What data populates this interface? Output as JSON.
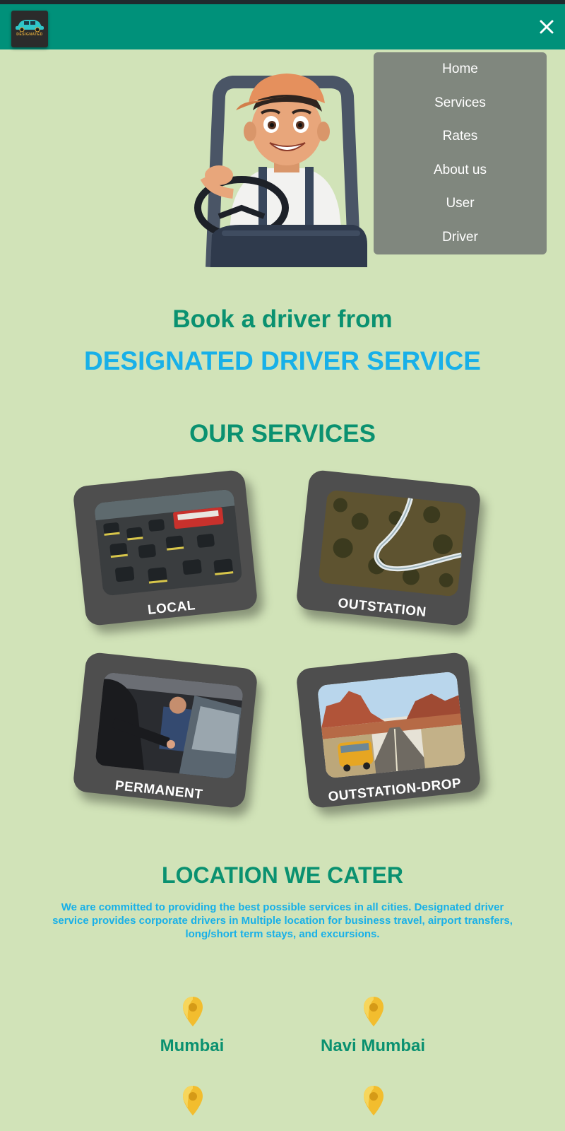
{
  "header": {
    "logo_icon": "car-logo-icon",
    "logo_text": "DESIGNATED",
    "close_icon": "close-icon",
    "bg_color": "#00917a"
  },
  "menu": {
    "items": [
      "Home",
      "Services",
      "Rates",
      "About us",
      "User",
      "Driver"
    ]
  },
  "hero": {
    "image": "cartoon-driver-illustration",
    "line1": "Book a driver from",
    "line2": "DESIGNATED DRIVER SERVICE"
  },
  "services": {
    "title": "OUR SERVICES",
    "cards": [
      {
        "label": "LOCAL",
        "image": "city-traffic-photo"
      },
      {
        "label": "OUTSTATION",
        "image": "mountain-road-photo"
      },
      {
        "label": "PERMANENT",
        "image": "chauffeur-door-photo"
      },
      {
        "label": "OUTSTATION-DROP",
        "image": "desert-road-van-photo"
      }
    ]
  },
  "locations": {
    "title": "LOCATION WE CATER",
    "description": "We are committed to providing the best possible services in all cities. Designated driver service provides corporate drivers in Multiple location for business travel, airport transfers, long/short term stays, and excursions.",
    "cities": [
      "Mumbai",
      "Navi Mumbai"
    ],
    "pin_icon": "location-pin-icon"
  },
  "colors": {
    "background": "#d1e3b8",
    "green": "#0a9170",
    "blue": "#18b0e8",
    "card": "#4e4e4e",
    "menu": "#80877e"
  }
}
